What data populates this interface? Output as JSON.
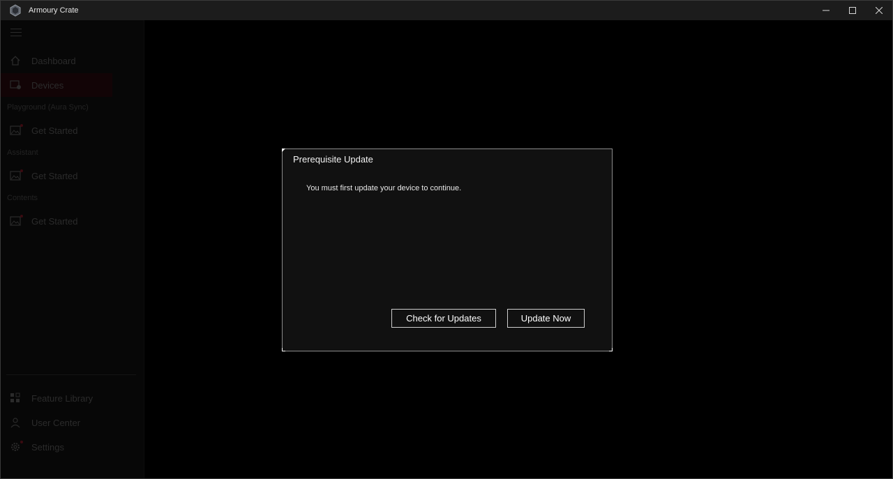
{
  "app": {
    "title": "Armoury Crate"
  },
  "window_controls": {
    "minimize": "—",
    "maximize": "☐",
    "close": "✕"
  },
  "sidebar": {
    "items": [
      {
        "label": "Dashboard",
        "icon": "home-icon"
      },
      {
        "label": "Devices",
        "icon": "devices-icon",
        "active": true
      }
    ],
    "sections": [
      {
        "title": "Playground (Aura Sync)",
        "item": {
          "label": "Get Started",
          "icon": "image-icon"
        }
      },
      {
        "title": "Assistant",
        "item": {
          "label": "Get Started",
          "icon": "image-icon"
        }
      },
      {
        "title": "Contents",
        "item": {
          "label": "Get Started",
          "icon": "image-icon"
        }
      }
    ],
    "bottom_items": [
      {
        "label": "Feature Library",
        "icon": "grid-icon"
      },
      {
        "label": "User Center",
        "icon": "user-icon"
      },
      {
        "label": "Settings",
        "icon": "gear-icon"
      }
    ]
  },
  "dialog": {
    "title": "Prerequisite Update",
    "message": "You must first update your device to continue.",
    "check_label": "Check for Updates",
    "update_label": "Update Now"
  },
  "colors": {
    "dialog_bg": "#111111",
    "dialog_border": "#8c8c8c",
    "titlebar_bg": "#1c1c1c",
    "accent_dim": "#3a0a10"
  }
}
